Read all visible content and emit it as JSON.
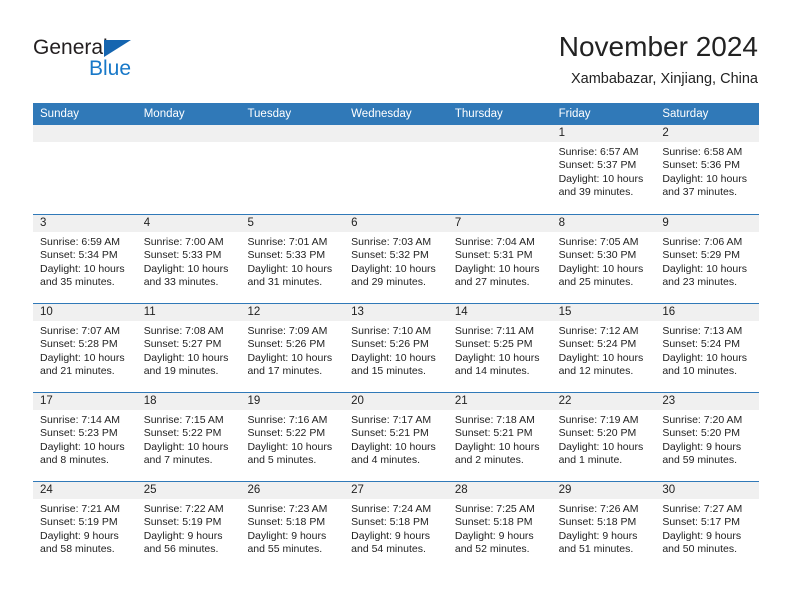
{
  "brand": {
    "name_part1": "General",
    "name_part2": "Blue",
    "color_primary": "#1878c8",
    "color_triangle": "#1565b0"
  },
  "header": {
    "title": "November 2024",
    "location": "Xambabazar, Xinjiang, China"
  },
  "calendar": {
    "header_bg": "#3079b8",
    "weekdays": [
      "Sunday",
      "Monday",
      "Tuesday",
      "Wednesday",
      "Thursday",
      "Friday",
      "Saturday"
    ],
    "weeks": [
      [
        {
          "empty": true
        },
        {
          "empty": true
        },
        {
          "empty": true
        },
        {
          "empty": true
        },
        {
          "empty": true
        },
        {
          "day": "1",
          "sunrise": "Sunrise: 6:57 AM",
          "sunset": "Sunset: 5:37 PM",
          "daylight": "Daylight: 10 hours and 39 minutes."
        },
        {
          "day": "2",
          "sunrise": "Sunrise: 6:58 AM",
          "sunset": "Sunset: 5:36 PM",
          "daylight": "Daylight: 10 hours and 37 minutes."
        }
      ],
      [
        {
          "day": "3",
          "sunrise": "Sunrise: 6:59 AM",
          "sunset": "Sunset: 5:34 PM",
          "daylight": "Daylight: 10 hours and 35 minutes."
        },
        {
          "day": "4",
          "sunrise": "Sunrise: 7:00 AM",
          "sunset": "Sunset: 5:33 PM",
          "daylight": "Daylight: 10 hours and 33 minutes."
        },
        {
          "day": "5",
          "sunrise": "Sunrise: 7:01 AM",
          "sunset": "Sunset: 5:33 PM",
          "daylight": "Daylight: 10 hours and 31 minutes."
        },
        {
          "day": "6",
          "sunrise": "Sunrise: 7:03 AM",
          "sunset": "Sunset: 5:32 PM",
          "daylight": "Daylight: 10 hours and 29 minutes."
        },
        {
          "day": "7",
          "sunrise": "Sunrise: 7:04 AM",
          "sunset": "Sunset: 5:31 PM",
          "daylight": "Daylight: 10 hours and 27 minutes."
        },
        {
          "day": "8",
          "sunrise": "Sunrise: 7:05 AM",
          "sunset": "Sunset: 5:30 PM",
          "daylight": "Daylight: 10 hours and 25 minutes."
        },
        {
          "day": "9",
          "sunrise": "Sunrise: 7:06 AM",
          "sunset": "Sunset: 5:29 PM",
          "daylight": "Daylight: 10 hours and 23 minutes."
        }
      ],
      [
        {
          "day": "10",
          "sunrise": "Sunrise: 7:07 AM",
          "sunset": "Sunset: 5:28 PM",
          "daylight": "Daylight: 10 hours and 21 minutes."
        },
        {
          "day": "11",
          "sunrise": "Sunrise: 7:08 AM",
          "sunset": "Sunset: 5:27 PM",
          "daylight": "Daylight: 10 hours and 19 minutes."
        },
        {
          "day": "12",
          "sunrise": "Sunrise: 7:09 AM",
          "sunset": "Sunset: 5:26 PM",
          "daylight": "Daylight: 10 hours and 17 minutes."
        },
        {
          "day": "13",
          "sunrise": "Sunrise: 7:10 AM",
          "sunset": "Sunset: 5:26 PM",
          "daylight": "Daylight: 10 hours and 15 minutes."
        },
        {
          "day": "14",
          "sunrise": "Sunrise: 7:11 AM",
          "sunset": "Sunset: 5:25 PM",
          "daylight": "Daylight: 10 hours and 14 minutes."
        },
        {
          "day": "15",
          "sunrise": "Sunrise: 7:12 AM",
          "sunset": "Sunset: 5:24 PM",
          "daylight": "Daylight: 10 hours and 12 minutes."
        },
        {
          "day": "16",
          "sunrise": "Sunrise: 7:13 AM",
          "sunset": "Sunset: 5:24 PM",
          "daylight": "Daylight: 10 hours and 10 minutes."
        }
      ],
      [
        {
          "day": "17",
          "sunrise": "Sunrise: 7:14 AM",
          "sunset": "Sunset: 5:23 PM",
          "daylight": "Daylight: 10 hours and 8 minutes."
        },
        {
          "day": "18",
          "sunrise": "Sunrise: 7:15 AM",
          "sunset": "Sunset: 5:22 PM",
          "daylight": "Daylight: 10 hours and 7 minutes."
        },
        {
          "day": "19",
          "sunrise": "Sunrise: 7:16 AM",
          "sunset": "Sunset: 5:22 PM",
          "daylight": "Daylight: 10 hours and 5 minutes."
        },
        {
          "day": "20",
          "sunrise": "Sunrise: 7:17 AM",
          "sunset": "Sunset: 5:21 PM",
          "daylight": "Daylight: 10 hours and 4 minutes."
        },
        {
          "day": "21",
          "sunrise": "Sunrise: 7:18 AM",
          "sunset": "Sunset: 5:21 PM",
          "daylight": "Daylight: 10 hours and 2 minutes."
        },
        {
          "day": "22",
          "sunrise": "Sunrise: 7:19 AM",
          "sunset": "Sunset: 5:20 PM",
          "daylight": "Daylight: 10 hours and 1 minute."
        },
        {
          "day": "23",
          "sunrise": "Sunrise: 7:20 AM",
          "sunset": "Sunset: 5:20 PM",
          "daylight": "Daylight: 9 hours and 59 minutes."
        }
      ],
      [
        {
          "day": "24",
          "sunrise": "Sunrise: 7:21 AM",
          "sunset": "Sunset: 5:19 PM",
          "daylight": "Daylight: 9 hours and 58 minutes."
        },
        {
          "day": "25",
          "sunrise": "Sunrise: 7:22 AM",
          "sunset": "Sunset: 5:19 PM",
          "daylight": "Daylight: 9 hours and 56 minutes."
        },
        {
          "day": "26",
          "sunrise": "Sunrise: 7:23 AM",
          "sunset": "Sunset: 5:18 PM",
          "daylight": "Daylight: 9 hours and 55 minutes."
        },
        {
          "day": "27",
          "sunrise": "Sunrise: 7:24 AM",
          "sunset": "Sunset: 5:18 PM",
          "daylight": "Daylight: 9 hours and 54 minutes."
        },
        {
          "day": "28",
          "sunrise": "Sunrise: 7:25 AM",
          "sunset": "Sunset: 5:18 PM",
          "daylight": "Daylight: 9 hours and 52 minutes."
        },
        {
          "day": "29",
          "sunrise": "Sunrise: 7:26 AM",
          "sunset": "Sunset: 5:18 PM",
          "daylight": "Daylight: 9 hours and 51 minutes."
        },
        {
          "day": "30",
          "sunrise": "Sunrise: 7:27 AM",
          "sunset": "Sunset: 5:17 PM",
          "daylight": "Daylight: 9 hours and 50 minutes."
        }
      ]
    ]
  }
}
